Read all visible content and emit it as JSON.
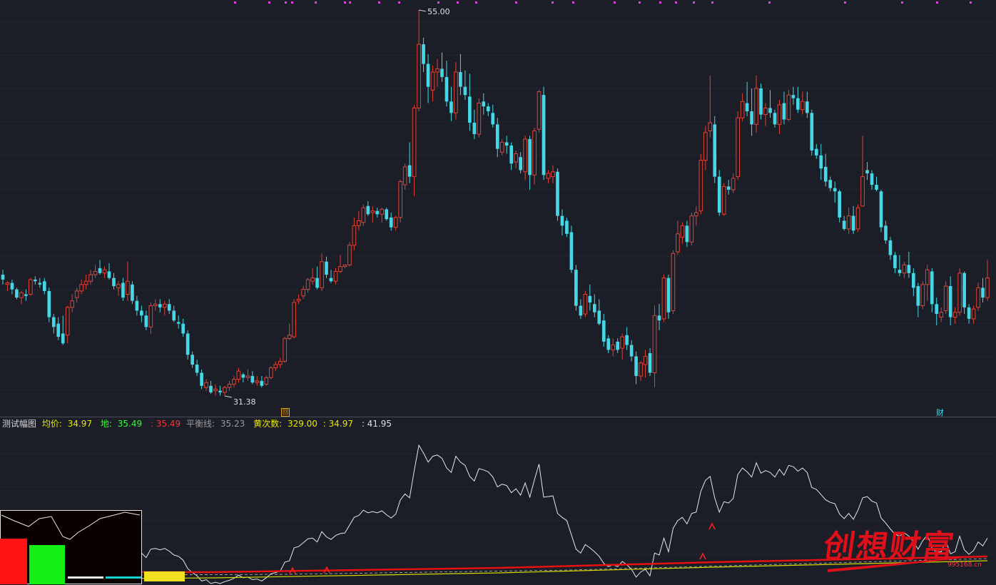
{
  "chart_data": {
    "type": "candlestick",
    "annotations": {
      "high_label": "55.00",
      "low_label": "31.38"
    },
    "ohlc": [
      [
        38.8,
        39.1,
        38.2,
        38.5
      ],
      [
        38.2,
        38.4,
        37.8,
        38.3
      ],
      [
        38.3,
        38.5,
        37.6,
        37.9
      ],
      [
        37.9,
        38.0,
        37.3,
        37.4
      ],
      [
        37.4,
        37.8,
        37.0,
        37.7
      ],
      [
        37.6,
        37.9,
        37.2,
        37.5
      ],
      [
        37.6,
        38.6,
        37.5,
        38.5
      ],
      [
        38.5,
        38.7,
        38.2,
        38.4
      ],
      [
        38.3,
        38.6,
        38.0,
        38.2
      ],
      [
        38.4,
        38.6,
        37.6,
        37.8
      ],
      [
        37.8,
        38.0,
        35.9,
        36.2
      ],
      [
        36.2,
        36.4,
        35.2,
        35.6
      ],
      [
        35.8,
        36.2,
        34.8,
        35.0
      ],
      [
        35.2,
        36.3,
        34.5,
        34.6
      ],
      [
        35.1,
        36.9,
        34.6,
        36.8
      ],
      [
        36.8,
        37.6,
        36.5,
        37.2
      ],
      [
        37.4,
        38.0,
        37.1,
        37.8
      ],
      [
        37.8,
        38.5,
        37.6,
        38.2
      ],
      [
        38.2,
        38.8,
        37.9,
        38.4
      ],
      [
        38.4,
        39.1,
        38.2,
        38.8
      ],
      [
        38.8,
        39.4,
        38.6,
        39.0
      ],
      [
        39.2,
        39.7,
        38.8,
        38.9
      ],
      [
        38.9,
        39.3,
        38.6,
        39.1
      ],
      [
        39.0,
        39.5,
        38.5,
        38.6
      ],
      [
        38.6,
        38.9,
        37.9,
        38.1
      ],
      [
        38.0,
        38.4,
        37.5,
        38.2
      ],
      [
        38.3,
        38.6,
        37.2,
        37.4
      ],
      [
        37.6,
        39.6,
        37.2,
        38.4
      ],
      [
        38.2,
        38.4,
        37.0,
        37.2
      ],
      [
        37.2,
        37.5,
        36.3,
        36.6
      ],
      [
        36.6,
        36.9,
        35.9,
        36.3
      ],
      [
        36.3,
        36.6,
        35.4,
        35.6
      ],
      [
        35.6,
        37.1,
        35.2,
        36.9
      ],
      [
        36.9,
        37.3,
        36.6,
        37.0
      ],
      [
        37.0,
        37.3,
        36.5,
        36.8
      ],
      [
        36.8,
        37.2,
        36.3,
        37.0
      ],
      [
        37.0,
        37.3,
        36.4,
        36.6
      ],
      [
        36.6,
        36.9,
        35.9,
        36.0
      ],
      [
        35.9,
        36.3,
        35.5,
        35.8
      ],
      [
        35.8,
        36.1,
        35.0,
        35.2
      ],
      [
        35.2,
        35.4,
        33.6,
        33.9
      ],
      [
        33.9,
        34.1,
        33.1,
        33.3
      ],
      [
        33.3,
        33.6,
        32.6,
        32.8
      ],
      [
        32.8,
        33.0,
        31.8,
        32.0
      ],
      [
        31.9,
        32.4,
        31.7,
        32.2
      ],
      [
        32.0,
        32.3,
        31.5,
        31.6
      ],
      [
        31.7,
        32.1,
        31.4,
        31.8
      ],
      [
        31.7,
        32.0,
        31.4,
        31.6
      ],
      [
        31.6,
        32.0,
        31.38,
        31.9
      ],
      [
        31.9,
        32.3,
        31.7,
        32.1
      ],
      [
        32.1,
        32.6,
        31.9,
        32.4
      ],
      [
        32.4,
        33.1,
        32.2,
        32.9
      ],
      [
        32.7,
        32.8,
        32.2,
        32.5
      ],
      [
        32.5,
        33.0,
        32.3,
        32.6
      ],
      [
        32.6,
        32.9,
        32.1,
        32.2
      ],
      [
        32.2,
        32.6,
        32.0,
        32.3
      ],
      [
        32.3,
        32.6,
        31.9,
        32.0
      ],
      [
        32.1,
        32.6,
        32.0,
        32.5
      ],
      [
        32.5,
        33.2,
        32.4,
        33.1
      ],
      [
        33.1,
        33.5,
        32.9,
        33.3
      ],
      [
        33.3,
        33.7,
        33.1,
        33.5
      ],
      [
        33.5,
        35.0,
        33.4,
        34.9
      ],
      [
        34.9,
        35.8,
        34.8,
        35.1
      ],
      [
        35.0,
        37.3,
        34.9,
        37.1
      ],
      [
        37.2,
        37.6,
        37.0,
        37.3
      ],
      [
        37.5,
        38.1,
        37.3,
        37.9
      ],
      [
        37.9,
        38.6,
        37.7,
        38.5
      ],
      [
        38.4,
        39.2,
        38.2,
        38.6
      ],
      [
        38.6,
        39.3,
        37.9,
        38.0
      ],
      [
        38.0,
        40.1,
        37.8,
        39.6
      ],
      [
        39.6,
        39.9,
        38.6,
        38.8
      ],
      [
        38.6,
        39.1,
        38.3,
        38.4
      ],
      [
        38.4,
        39.2,
        38.2,
        39.0
      ],
      [
        39.0,
        40.0,
        38.9,
        39.3
      ],
      [
        39.3,
        39.4,
        39.2,
        39.4
      ],
      [
        39.4,
        40.8,
        39.3,
        40.6
      ],
      [
        40.6,
        42.3,
        40.3,
        41.8
      ],
      [
        41.8,
        42.7,
        41.5,
        42.1
      ],
      [
        42.0,
        43.1,
        41.8,
        42.9
      ],
      [
        43.0,
        43.3,
        42.4,
        42.5
      ],
      [
        42.6,
        43.0,
        42.0,
        42.7
      ],
      [
        42.7,
        42.9,
        42.3,
        42.5
      ],
      [
        42.5,
        42.9,
        42.0,
        42.8
      ],
      [
        42.8,
        42.9,
        42.1,
        42.2
      ],
      [
        42.3,
        42.6,
        41.5,
        41.7
      ],
      [
        41.7,
        42.4,
        41.5,
        42.3
      ],
      [
        42.3,
        44.6,
        42.0,
        44.5
      ],
      [
        44.3,
        45.6,
        44.0,
        45.4
      ],
      [
        45.5,
        46.9,
        44.4,
        44.8
      ],
      [
        44.8,
        49.2,
        43.6,
        49.0
      ],
      [
        49.0,
        55.0,
        48.8,
        52.9
      ],
      [
        52.9,
        53.3,
        51.2,
        51.7
      ],
      [
        51.7,
        52.3,
        49.3,
        50.3
      ],
      [
        50.1,
        51.6,
        49.4,
        51.2
      ],
      [
        51.2,
        52.0,
        50.3,
        51.4
      ],
      [
        51.4,
        52.4,
        50.6,
        50.9
      ],
      [
        50.9,
        51.9,
        49.1,
        49.4
      ],
      [
        49.4,
        50.3,
        48.2,
        48.7
      ],
      [
        48.7,
        51.8,
        48.3,
        51.2
      ],
      [
        51.2,
        52.3,
        49.8,
        50.3
      ],
      [
        50.3,
        51.3,
        49.5,
        49.8
      ],
      [
        49.7,
        51.1,
        47.6,
        48.1
      ],
      [
        48.1,
        48.9,
        47.1,
        47.4
      ],
      [
        47.4,
        49.6,
        47.2,
        49.3
      ],
      [
        49.4,
        49.9,
        48.6,
        49.1
      ],
      [
        49.1,
        49.3,
        48.5,
        48.8
      ],
      [
        48.7,
        49.2,
        47.8,
        48.0
      ],
      [
        48.0,
        48.4,
        46.0,
        46.5
      ],
      [
        46.3,
        47.1,
        46.1,
        46.9
      ],
      [
        46.9,
        47.3,
        46.2,
        46.7
      ],
      [
        46.7,
        46.9,
        45.2,
        45.6
      ],
      [
        45.7,
        46.4,
        45.3,
        46.2
      ],
      [
        46.0,
        46.3,
        45.0,
        45.2
      ],
      [
        45.1,
        47.3,
        44.6,
        47.1
      ],
      [
        47.1,
        47.3,
        44.0,
        44.9
      ],
      [
        44.9,
        47.8,
        44.3,
        47.6
      ],
      [
        47.7,
        50.1,
        47.5,
        50.0
      ],
      [
        49.8,
        50.3,
        44.6,
        44.9
      ],
      [
        44.7,
        45.2,
        44.4,
        45.0
      ],
      [
        44.8,
        45.5,
        44.4,
        45.1
      ],
      [
        45.1,
        45.3,
        42.1,
        42.4
      ],
      [
        42.4,
        42.8,
        41.2,
        41.8
      ],
      [
        42.1,
        42.3,
        41.1,
        41.3
      ],
      [
        41.4,
        41.8,
        38.9,
        39.1
      ],
      [
        39.1,
        39.4,
        36.6,
        36.9
      ],
      [
        36.9,
        37.3,
        36.1,
        36.3
      ],
      [
        36.4,
        37.8,
        36.2,
        37.6
      ],
      [
        37.5,
        38.2,
        36.6,
        37.1
      ],
      [
        37.0,
        37.6,
        36.2,
        36.5
      ],
      [
        36.6,
        37.3,
        35.7,
        35.8
      ],
      [
        36.0,
        36.4,
        34.4,
        34.7
      ],
      [
        34.9,
        35.1,
        34.0,
        34.2
      ],
      [
        34.2,
        34.9,
        33.8,
        34.5
      ],
      [
        34.7,
        34.9,
        34.0,
        34.2
      ],
      [
        34.3,
        35.2,
        33.6,
        35.0
      ],
      [
        35.1,
        35.6,
        34.2,
        34.5
      ],
      [
        34.5,
        34.8,
        33.5,
        33.8
      ],
      [
        33.8,
        34.1,
        32.1,
        32.6
      ],
      [
        32.6,
        33.5,
        32.3,
        33.4
      ],
      [
        33.3,
        34.2,
        32.5,
        33.8
      ],
      [
        34.0,
        34.3,
        32.6,
        32.8
      ],
      [
        32.8,
        36.9,
        31.9,
        36.3
      ],
      [
        36.3,
        37.0,
        35.4,
        36.0
      ],
      [
        36.1,
        38.8,
        35.9,
        38.6
      ],
      [
        38.6,
        38.8,
        36.1,
        36.5
      ],
      [
        36.6,
        40.3,
        36.4,
        40.1
      ],
      [
        40.2,
        42.1,
        40.0,
        41.3
      ],
      [
        41.1,
        42.0,
        40.7,
        41.8
      ],
      [
        41.8,
        42.1,
        40.5,
        40.8
      ],
      [
        40.8,
        42.6,
        40.6,
        42.4
      ],
      [
        42.4,
        43.0,
        41.8,
        42.6
      ],
      [
        42.7,
        46.2,
        42.5,
        45.8
      ],
      [
        45.8,
        47.9,
        45.2,
        47.5
      ],
      [
        47.6,
        51.0,
        47.2,
        48.1
      ],
      [
        48.0,
        48.5,
        44.4,
        44.8
      ],
      [
        44.8,
        45.2,
        42.4,
        42.6
      ],
      [
        42.5,
        44.4,
        42.4,
        44.2
      ],
      [
        44.2,
        44.6,
        43.7,
        44.0
      ],
      [
        44.0,
        45.0,
        43.8,
        44.7
      ],
      [
        44.8,
        48.8,
        44.6,
        48.4
      ],
      [
        48.4,
        49.9,
        48.2,
        49.4
      ],
      [
        49.3,
        50.6,
        48.5,
        48.8
      ],
      [
        48.8,
        50.2,
        47.3,
        48.0
      ],
      [
        48.0,
        51.0,
        47.5,
        50.2
      ],
      [
        50.2,
        50.5,
        48.3,
        48.6
      ],
      [
        48.6,
        49.3,
        47.9,
        49.0
      ],
      [
        49.0,
        50.1,
        48.4,
        48.7
      ],
      [
        48.7,
        48.9,
        47.8,
        48.0
      ],
      [
        48.0,
        49.5,
        47.4,
        49.2
      ],
      [
        49.3,
        50.0,
        48.0,
        48.3
      ],
      [
        48.3,
        50.1,
        48.2,
        49.8
      ],
      [
        49.8,
        50.3,
        49.2,
        49.6
      ],
      [
        49.6,
        50.3,
        48.7,
        48.9
      ],
      [
        48.9,
        50.0,
        48.6,
        49.4
      ],
      [
        49.4,
        50.0,
        48.4,
        48.7
      ],
      [
        48.7,
        48.9,
        46.1,
        46.4
      ],
      [
        46.5,
        46.8,
        45.9,
        46.1
      ],
      [
        46.1,
        46.8,
        44.6,
        45.3
      ],
      [
        45.4,
        46.2,
        44.2,
        44.5
      ],
      [
        44.6,
        44.8,
        43.9,
        44.1
      ],
      [
        44.1,
        44.5,
        43.2,
        43.9
      ],
      [
        43.9,
        44.0,
        42.0,
        42.3
      ],
      [
        42.1,
        42.4,
        41.5,
        41.6
      ],
      [
        41.6,
        42.9,
        41.3,
        42.4
      ],
      [
        42.4,
        43.0,
        41.3,
        41.5
      ],
      [
        41.6,
        43.1,
        41.4,
        42.9
      ],
      [
        43.0,
        47.3,
        43.0,
        44.8
      ],
      [
        45.2,
        45.7,
        44.6,
        45.0
      ],
      [
        45.0,
        45.2,
        44.0,
        44.3
      ],
      [
        44.3,
        44.8,
        43.9,
        44.0
      ],
      [
        43.9,
        44.0,
        41.4,
        41.7
      ],
      [
        41.8,
        42.1,
        40.7,
        40.9
      ],
      [
        40.9,
        41.1,
        39.7,
        40.0
      ],
      [
        40.0,
        40.2,
        38.9,
        39.2
      ],
      [
        39.1,
        40.0,
        38.7,
        38.9
      ],
      [
        38.9,
        39.6,
        38.6,
        39.4
      ],
      [
        39.4,
        40.2,
        38.6,
        38.9
      ],
      [
        38.9,
        39.2,
        37.5,
        38.0
      ],
      [
        38.1,
        38.3,
        36.2,
        36.9
      ],
      [
        36.9,
        38.4,
        36.7,
        38.2
      ],
      [
        38.2,
        39.4,
        37.2,
        39.1
      ],
      [
        39.0,
        39.2,
        36.5,
        37.0
      ],
      [
        37.0,
        37.4,
        35.7,
        36.4
      ],
      [
        36.2,
        36.8,
        35.9,
        36.5
      ],
      [
        36.6,
        38.4,
        36.4,
        38.1
      ],
      [
        38.1,
        38.7,
        35.7,
        36.2
      ],
      [
        36.2,
        36.8,
        35.8,
        36.5
      ],
      [
        36.5,
        39.2,
        36.3,
        38.9
      ],
      [
        38.9,
        39.0,
        36.4,
        36.8
      ],
      [
        36.8,
        37.0,
        35.8,
        36.1
      ],
      [
        36.1,
        36.9,
        35.8,
        36.7
      ],
      [
        36.8,
        38.3,
        36.6,
        38.0
      ],
      [
        38.0,
        38.6,
        37.1,
        37.4
      ],
      [
        37.4,
        39.7,
        37.2,
        38.6
      ]
    ]
  },
  "price_labels": {
    "high": "55.00",
    "low": "31.38"
  },
  "marker_glyph": "回",
  "fin_label": "财",
  "indicator": {
    "name": "测试幅图",
    "junjia_label": "均价:",
    "junjia_value": "34.97",
    "di_label": "地:",
    "di_value": "35.49",
    "red_value": ": 35.49",
    "balance_label": "平衡线:",
    "balance_value": "35.23",
    "huang_label": "黄次数:",
    "huang_value": "329.00",
    "huang_sep_value": ": 34.97",
    "last_value": ": 41.95"
  },
  "logo": {
    "text": "创想财富",
    "site": "995168.cn"
  },
  "colors": {
    "up": "#e34234",
    "down": "#46d7e6",
    "background": "#1b1d27",
    "grid": "#3a3d4a"
  }
}
